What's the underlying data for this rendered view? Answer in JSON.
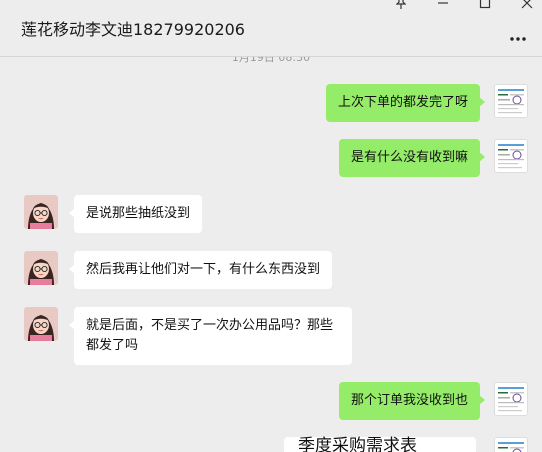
{
  "header": {
    "title": "莲花移动李文迪18279920206"
  },
  "chat": {
    "timestamp": "1月19日 08:30",
    "messages": [
      {
        "side": "right",
        "text": "上次下单的都发完了呀"
      },
      {
        "side": "right",
        "text": "是有什么没有收到嘛"
      },
      {
        "side": "left",
        "text": "是说那些抽纸没到"
      },
      {
        "side": "left",
        "text": "然后我再让他们对一下，有什么东西没到"
      },
      {
        "side": "left",
        "text": "就是后面，不是买了一次办公用品吗？那些都发了吗"
      },
      {
        "side": "right",
        "text": "那个订单我没收到也"
      }
    ],
    "partial_text": "季度采购需求表"
  },
  "icons": [
    "pin-icon",
    "minimize-icon",
    "maximize-icon",
    "close-icon",
    "more-icon"
  ],
  "colors": {
    "my_bubble": "#95ec69",
    "their_bubble": "#ffffff",
    "background": "#ededed"
  }
}
